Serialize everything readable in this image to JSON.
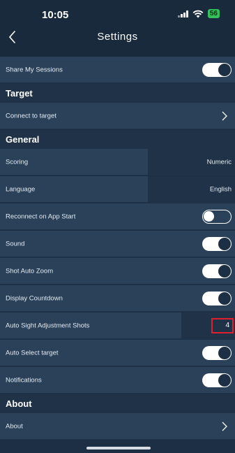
{
  "status_bar": {
    "time": "10:05",
    "battery": "56"
  },
  "header": {
    "title": "Settings"
  },
  "rows": {
    "share_sessions": {
      "label": "Share My Sessions",
      "toggle": true
    },
    "target_header": "Target",
    "connect_target": {
      "label": "Connect to target"
    },
    "general_header": "General",
    "scoring": {
      "label": "Scoring",
      "value": "Numeric"
    },
    "language": {
      "label": "Language",
      "value": "English"
    },
    "reconnect": {
      "label": "Reconnect on App Start",
      "toggle": false
    },
    "sound": {
      "label": "Sound",
      "toggle": true
    },
    "shot_auto_zoom": {
      "label": "Shot Auto Zoom",
      "toggle": true
    },
    "display_countdown": {
      "label": "Display Countdown",
      "toggle": true
    },
    "auto_sight": {
      "label": "Auto Sight Adjustment Shots",
      "value": "4"
    },
    "auto_select": {
      "label": "Auto Select target",
      "toggle": true
    },
    "notifications": {
      "label": "Notifications",
      "toggle": true
    },
    "about_header": "About",
    "about": {
      "label": "About"
    }
  },
  "colors": {
    "background": "#1d2f44",
    "row": "#2a4159",
    "accent_highlight": "#e0202e",
    "battery": "#32c05a"
  },
  "icons": [
    "back-chevron-icon",
    "chevron-right-icon",
    "signal-icon",
    "wifi-icon",
    "battery-icon"
  ]
}
